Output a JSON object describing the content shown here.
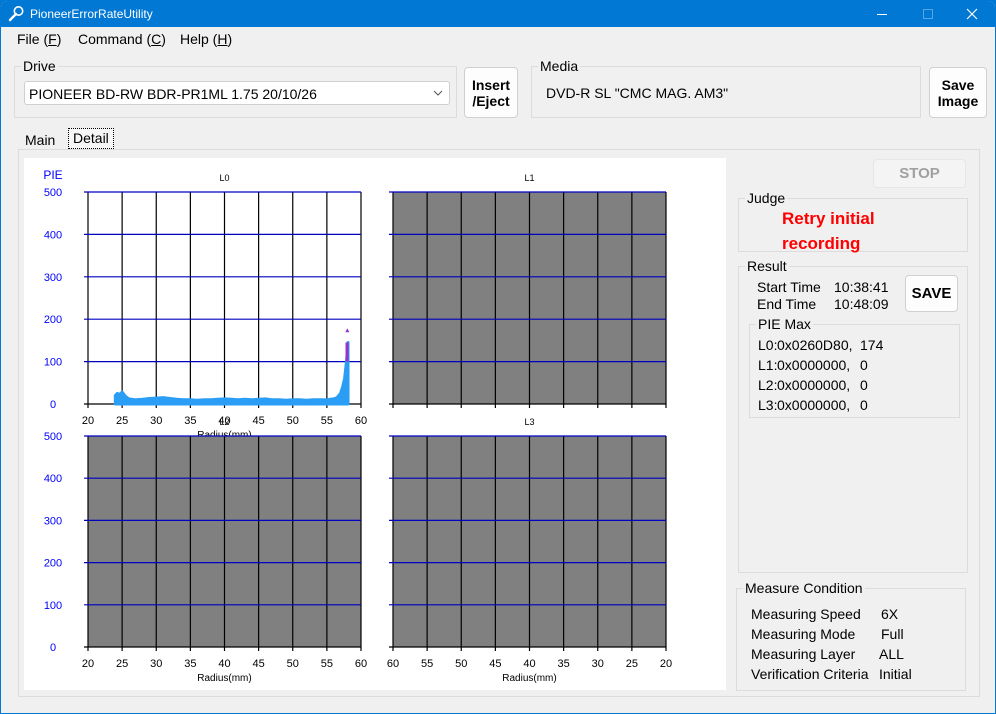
{
  "window": {
    "title": "PioneerErrorRateUtility",
    "controls": {
      "minimize": "minimize",
      "maximize": "maximize",
      "close": "close"
    }
  },
  "menu": [
    {
      "label": "File (",
      "key": "F",
      "suffix": ")"
    },
    {
      "label": "Command (",
      "key": "C",
      "suffix": ")"
    },
    {
      "label": "Help (",
      "key": "H",
      "suffix": ")"
    }
  ],
  "drive": {
    "legend": "Drive",
    "selected": "PIONEER BD-RW BDR-PR1ML 1.75 20/10/26"
  },
  "insert_eject": {
    "line1": "Insert",
    "line2": "/Eject"
  },
  "media": {
    "legend": "Media",
    "value": "DVD-R SL \"CMC MAG. AM3\""
  },
  "save_image": {
    "line1": "Save",
    "line2": "Image"
  },
  "tabs": [
    {
      "label": "Main",
      "active": false
    },
    {
      "label": "Detail",
      "active": true
    }
  ],
  "stop_button": "STOP",
  "judge": {
    "legend": "Judge",
    "line1": "Retry initial",
    "line2": "recording",
    "color": "#ff0000"
  },
  "result": {
    "legend": "Result",
    "start_label": "Start Time",
    "start_value": "10:38:41",
    "end_label": "End Time",
    "end_value": "10:48:09",
    "save_button": "SAVE",
    "pie_max": {
      "legend": "PIE Max",
      "rows": [
        {
          "layer": "L0:",
          "address": "0x0260D80,",
          "value": "174"
        },
        {
          "layer": "L1:",
          "address": "0x0000000,",
          "value": "0"
        },
        {
          "layer": "L2:",
          "address": "0x0000000,",
          "value": "0"
        },
        {
          "layer": "L3:",
          "address": "0x0000000,",
          "value": "0"
        }
      ]
    }
  },
  "measure_condition": {
    "legend": "Measure Condition",
    "rows": [
      {
        "label": "Measuring Speed",
        "value": "6X"
      },
      {
        "label": "Measuring Mode",
        "value": "Full"
      },
      {
        "label": "Measuring Layer",
        "value": "ALL"
      },
      {
        "label": "Verification Criteria",
        "value": "Initial"
      }
    ]
  },
  "colors": {
    "title_bar": "#0078d4",
    "axis_text": "#0000ff",
    "gridline_h": "#0000c0",
    "gridline_v": "#000000",
    "inactive_plot": "#808080",
    "pie_series": "#2a9df4",
    "pie_peak": "#9932cc"
  },
  "chart_data": [
    {
      "type": "area",
      "title": "L0",
      "ylabel": "PIE",
      "xlabel": "Radius(mm)",
      "xlim": [
        20,
        60
      ],
      "ylim": [
        0,
        500
      ],
      "x_ticks": [
        20,
        25,
        30,
        35,
        40,
        45,
        50,
        55,
        60
      ],
      "y_ticks": [
        0,
        100,
        200,
        300,
        400,
        500
      ],
      "grid": true,
      "active": true,
      "series": [
        {
          "name": "PIE",
          "x": [
            24,
            24.3,
            24.6,
            25,
            25.5,
            26,
            27,
            28,
            29,
            30,
            31,
            32,
            33,
            34,
            35,
            36,
            37,
            38,
            39,
            40,
            41,
            42,
            43,
            44,
            45,
            46,
            47,
            48,
            49,
            50,
            51,
            52,
            53,
            54,
            55,
            55.5,
            56,
            56.5,
            57,
            57.3,
            57.6,
            57.8,
            58,
            58.1
          ],
          "values": [
            20,
            25,
            22,
            28,
            18,
            12,
            10,
            11,
            13,
            14,
            15,
            13,
            11,
            10,
            10,
            9,
            10,
            10,
            11,
            12,
            11,
            10,
            11,
            10,
            11,
            12,
            10,
            10,
            9,
            10,
            10,
            9,
            10,
            10,
            10,
            11,
            12,
            15,
            25,
            40,
            60,
            90,
            120,
            145
          ]
        }
      ],
      "peak": {
        "x": 58,
        "value": 174
      }
    },
    {
      "type": "area",
      "title": "L1",
      "xlabel": "",
      "xlim": [
        20,
        60
      ],
      "ylim": [
        0,
        500
      ],
      "grid": true,
      "active": false,
      "series": []
    },
    {
      "type": "area",
      "title": "L2",
      "xlabel": "Radius(mm)",
      "xlim": [
        20,
        60
      ],
      "ylim": [
        0,
        500
      ],
      "x_ticks": [
        20,
        25,
        30,
        35,
        40,
        45,
        50,
        55,
        60
      ],
      "y_ticks": [
        0,
        100,
        200,
        300,
        400,
        500
      ],
      "grid": true,
      "active": false,
      "series": []
    },
    {
      "type": "area",
      "title": "L3",
      "xlabel": "Radius(mm)",
      "xlim": [
        60,
        20
      ],
      "ylim": [
        0,
        500
      ],
      "x_ticks": [
        60,
        55,
        50,
        45,
        40,
        35,
        30,
        25,
        20
      ],
      "grid": true,
      "active": false,
      "series": []
    }
  ]
}
